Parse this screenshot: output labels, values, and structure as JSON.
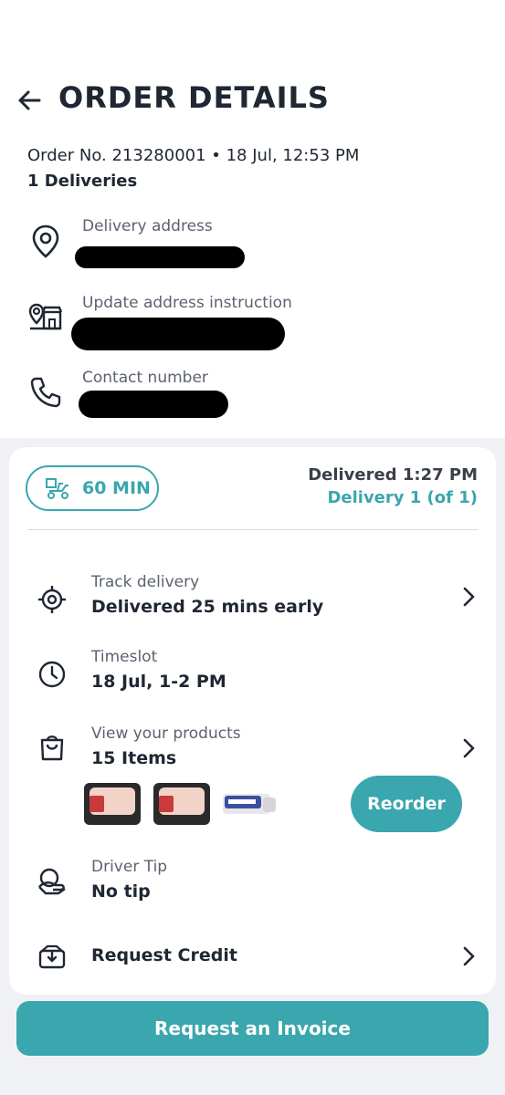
{
  "header": {
    "title": "ORDER DETAILS",
    "back_icon": "arrow-left-icon"
  },
  "order": {
    "line": "Order No. 213280001 • 18 Jul, 12:53 PM",
    "deliveries": "1 Deliveries"
  },
  "info": {
    "delivery_address_label": "Delivery address",
    "address_instruction_label": "Update address instruction",
    "contact_label": "Contact number"
  },
  "delivery_card": {
    "eta_pill": "60 MIN",
    "status": "Delivered 1:27 PM",
    "delivery_count": "Delivery 1 (of 1)",
    "rows": {
      "track_label": "Track delivery",
      "track_value": "Delivered 25 mins early",
      "timeslot_label": "Timeslot",
      "timeslot_value": "18 Jul, 1-2 PM",
      "products_label": "View your products",
      "products_value": "15 Items",
      "tip_label": "Driver Tip",
      "tip_value": "No tip",
      "credit_value": "Request Credit"
    },
    "reorder_label": "Reorder"
  },
  "footer": {
    "invoice_button": "Request an Invoice"
  },
  "colors": {
    "accent": "#3aa6ad",
    "text": "#1f2733",
    "muted": "#5b6270",
    "background": "#f0f1f5"
  }
}
